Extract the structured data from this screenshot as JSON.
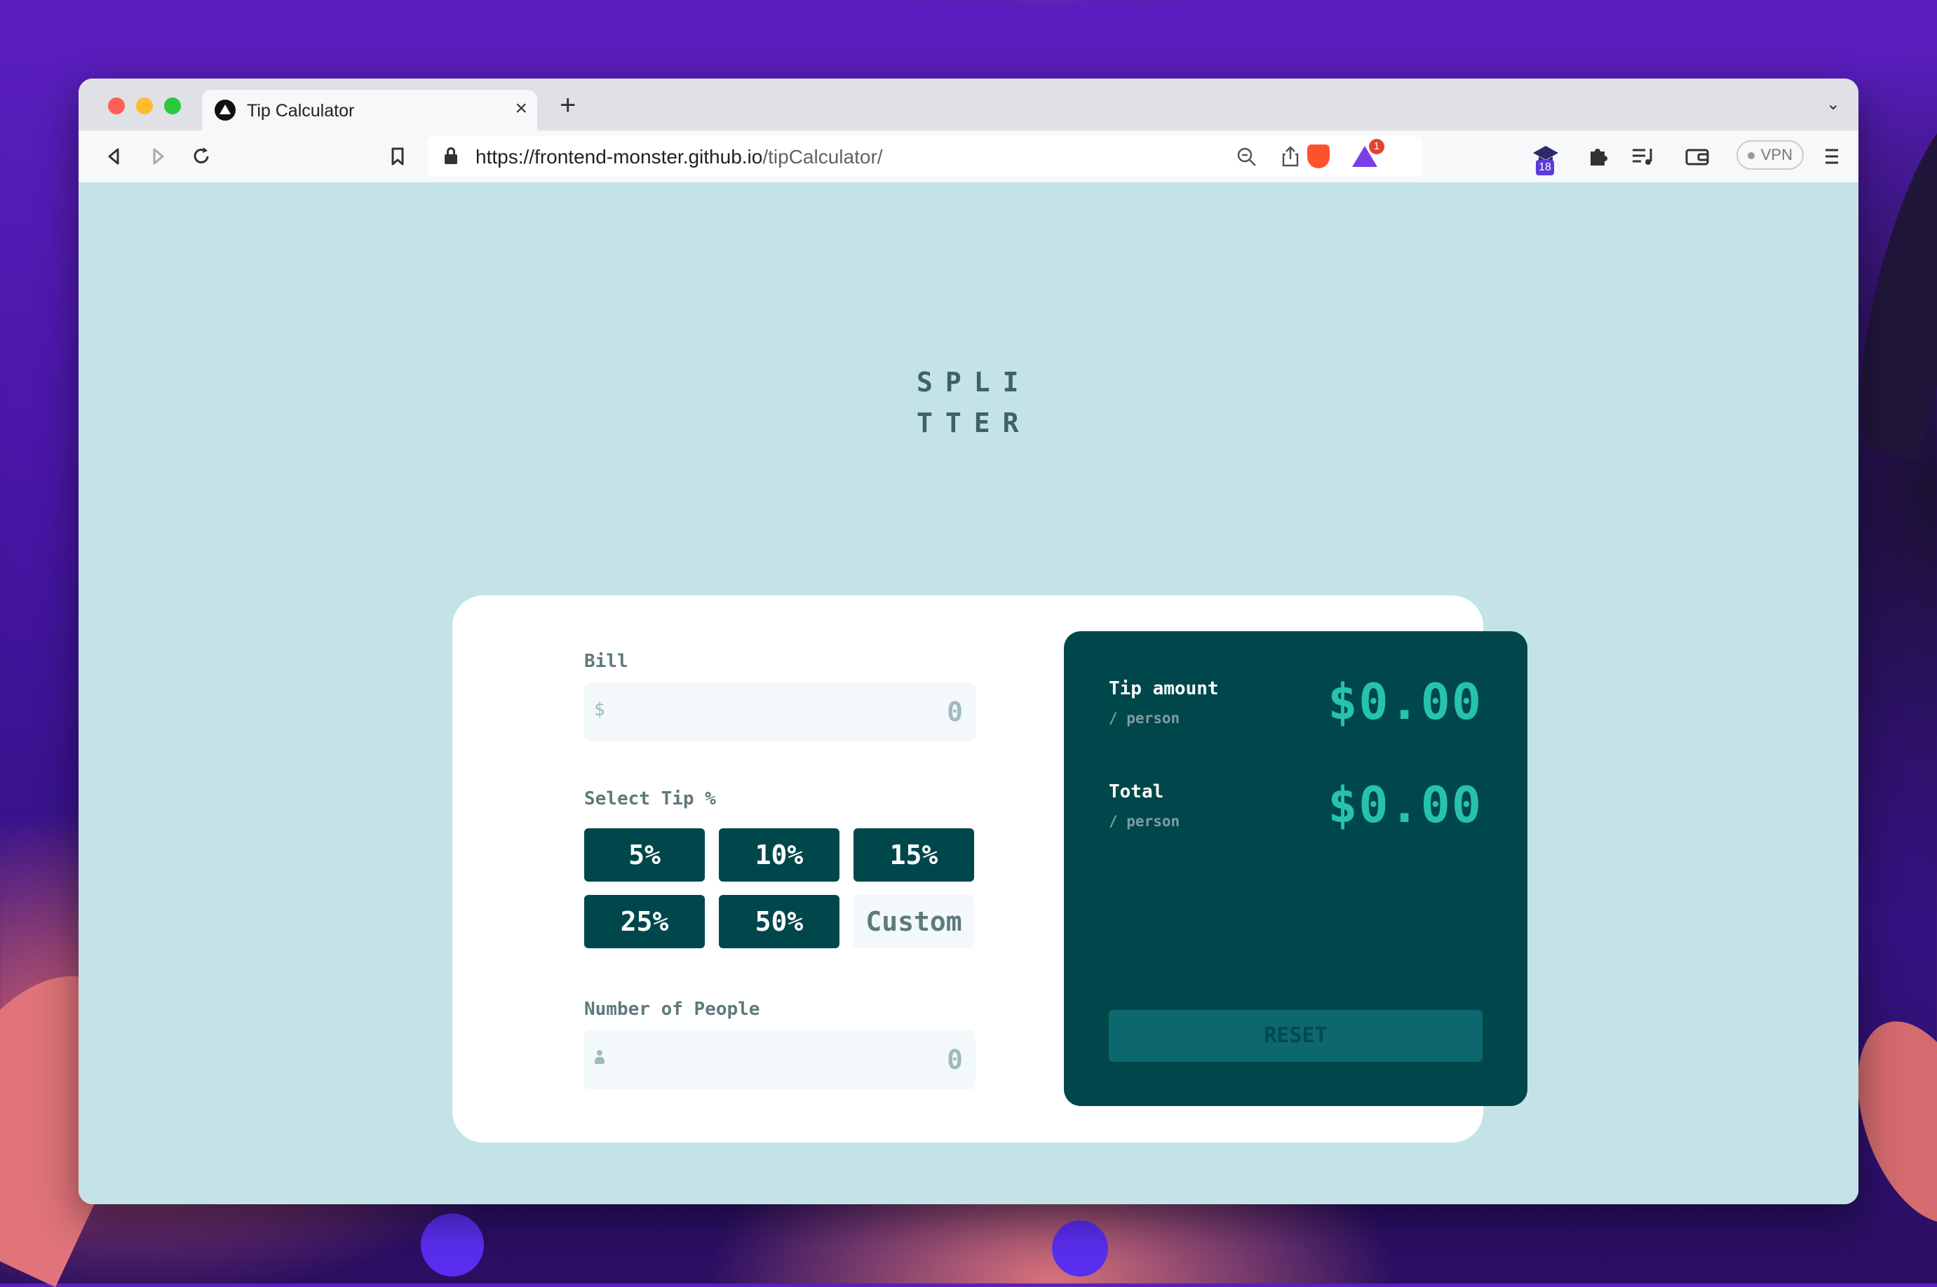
{
  "browser": {
    "tab_title": "Tip Calculator",
    "tab_close": "×",
    "new_tab": "+",
    "tab_menu": "⌄",
    "url_host": "https://frontend-monster.github.io",
    "url_path": "/tipCalculator/",
    "brave_badge": "1",
    "extension_badge": "18",
    "vpn_label": "VPN",
    "icons": {
      "back": "back-icon",
      "forward": "forward-icon",
      "reload": "reload-icon",
      "bookmark": "bookmark-icon",
      "lock": "lock-icon",
      "zoom": "zoom-icon",
      "share": "share-icon",
      "menu": "menu-icon"
    }
  },
  "app": {
    "logo_line1": "SPLI",
    "logo_line2": "TTER",
    "bill": {
      "label": "Bill",
      "prefix": "$",
      "value": "0"
    },
    "select_tip": {
      "label": "Select Tip %",
      "options": [
        "5%",
        "10%",
        "15%",
        "25%",
        "50%"
      ],
      "custom_placeholder": "Custom"
    },
    "people": {
      "label": "Number of People",
      "value": "0"
    },
    "results": {
      "tip_label": "Tip amount",
      "tip_sub": "/ person",
      "tip_value": "$0.00",
      "total_label": "Total",
      "total_sub": "/ person",
      "total_value": "$0.00",
      "reset_label": "RESET"
    }
  },
  "colors": {
    "page_bg": "#c4e3e6",
    "card_bg": "#ffffff",
    "dark_cyan": "#00474b",
    "accent": "#26c2ae",
    "reset_bg": "#0d686d"
  }
}
